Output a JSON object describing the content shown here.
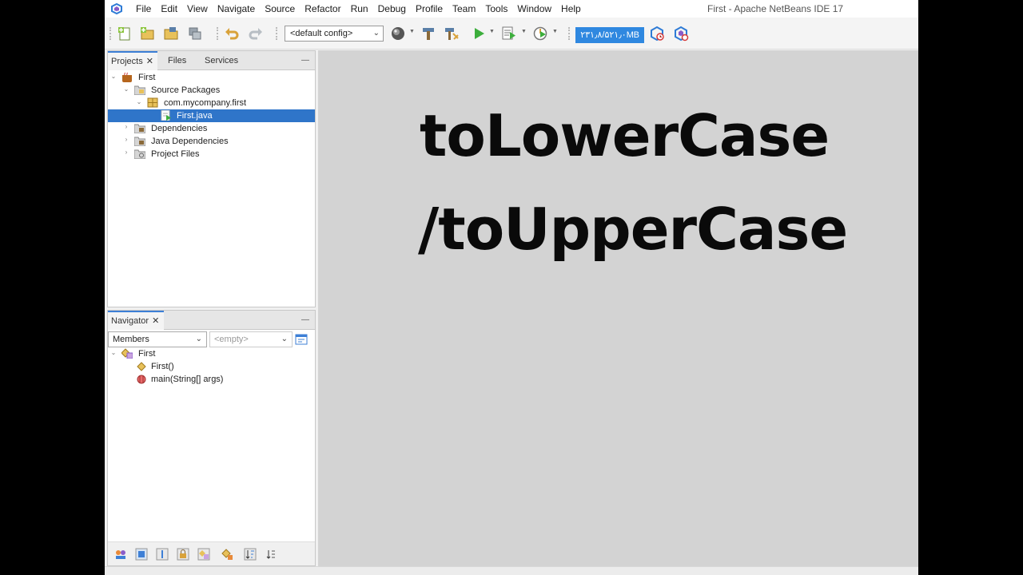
{
  "window": {
    "title": "First - Apache NetBeans IDE 17"
  },
  "menu": [
    "File",
    "Edit",
    "View",
    "Navigate",
    "Source",
    "Refactor",
    "Run",
    "Debug",
    "Profile",
    "Team",
    "Tools",
    "Window",
    "Help"
  ],
  "toolbar": {
    "config_value": "<default config>",
    "memory_indicator": "۲۳۱٫۸/۵۲۱٫۰MB",
    "icons": [
      "new-file-icon",
      "new-project-icon",
      "open-project-icon",
      "close-project-icon",
      "undo-icon",
      "redo-icon",
      "globe-icon",
      "build-icon",
      "clean-build-icon",
      "run-icon",
      "debug-icon",
      "profile-icon",
      "gc-icon",
      "gc-profile-icon"
    ]
  },
  "projects_panel": {
    "tabs": [
      "Projects",
      "Files",
      "Services"
    ],
    "active_tab": "Projects",
    "tree": [
      {
        "label": "First",
        "icon": "project-icon"
      },
      {
        "label": "Source Packages",
        "icon": "folder-icon"
      },
      {
        "label": "com.mycompany.first",
        "icon": "package-icon"
      },
      {
        "label": "First.java",
        "icon": "java-file-icon",
        "selected": true
      },
      {
        "label": "Dependencies",
        "icon": "folder-icon"
      },
      {
        "label": "Java Dependencies",
        "icon": "folder-icon"
      },
      {
        "label": "Project Files",
        "icon": "folder-icon"
      }
    ]
  },
  "navigator": {
    "title": "Navigator",
    "members_select": "Members",
    "filter_select": "<empty>",
    "tree": [
      {
        "label": "First",
        "icon": "class-icon"
      },
      {
        "label": "First()",
        "icon": "constructor-icon"
      },
      {
        "label": "main(String[] args)",
        "icon": "method-icon"
      }
    ]
  },
  "editor": {
    "line1": "toLowerCase",
    "line2": "/toUpperCase"
  },
  "colors": {
    "selection": "#2f75c9",
    "accent": "#3d7fd6",
    "editor_bg": "#d3d3d3"
  }
}
